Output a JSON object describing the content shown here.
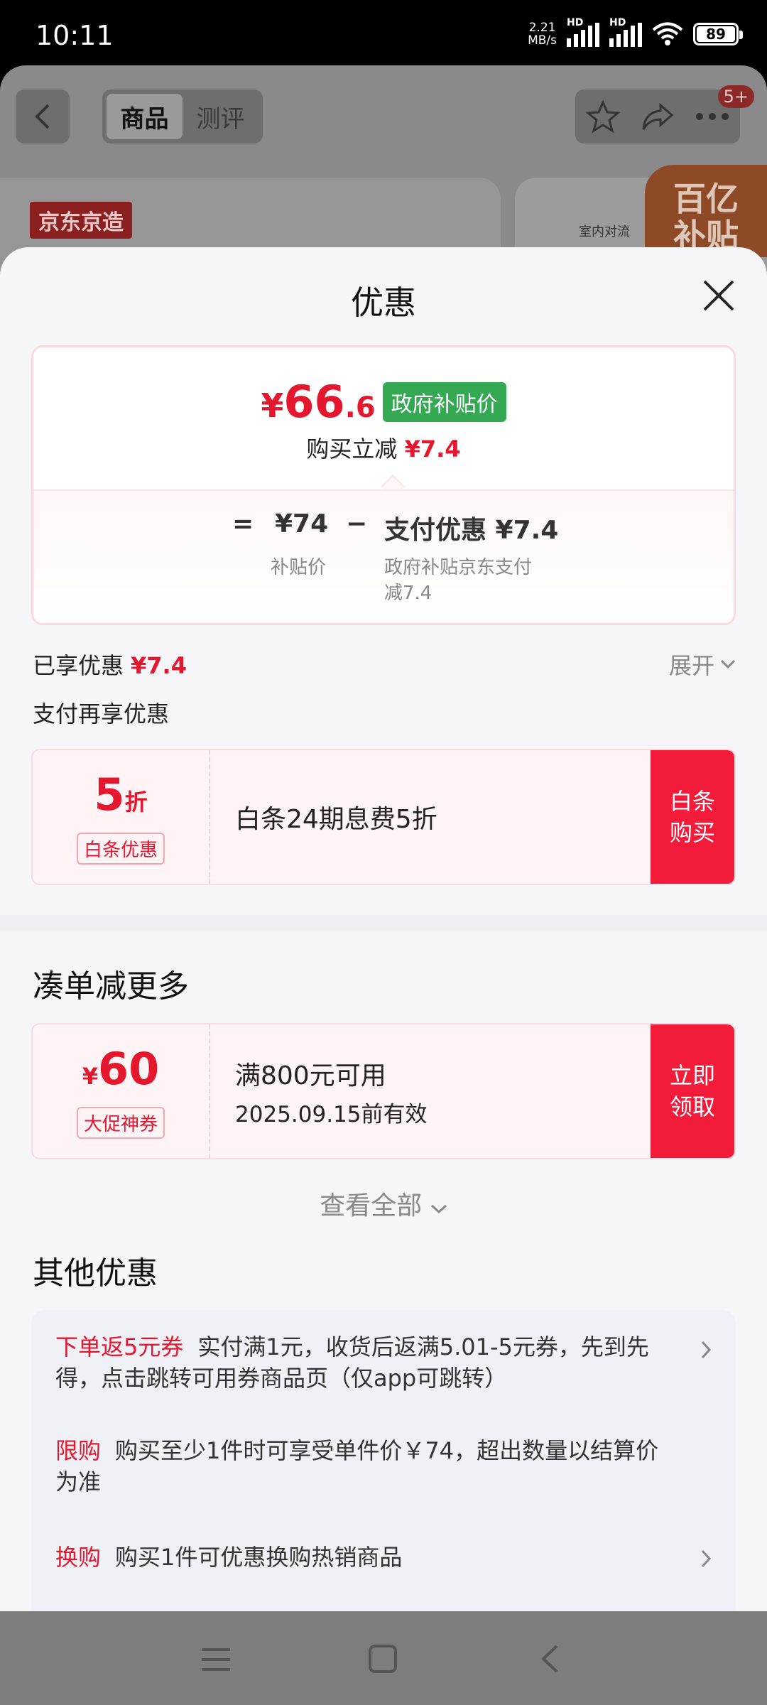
{
  "status_bar": {
    "time": "10:11",
    "net_speed_value": "2.21",
    "net_speed_unit": "MB/s",
    "sim1": "HD",
    "sim2": "HD",
    "battery": "89"
  },
  "background_page": {
    "tabs": [
      "商品",
      "测评"
    ],
    "badge": "5+",
    "brand_logo": "京东京造",
    "subsidy_label_line1": "百亿",
    "subsidy_label_line2": "补贴",
    "small_text": "室内对流"
  },
  "sheet": {
    "title": "优惠",
    "price": {
      "currency": "¥",
      "integer": "66",
      "decimal": ".6",
      "tag": "政府补贴价",
      "reduce_label": "购买立减",
      "reduce_amount": "¥7.4"
    },
    "breakdown": {
      "eq": "=",
      "subsidy_value": "¥74",
      "subsidy_label": "补贴价",
      "minus": "−",
      "pay_value": "支付优惠 ¥7.4",
      "pay_label_line1": "政府补贴京东支付",
      "pay_label_line2": "减7.4"
    },
    "enjoyed_label": "已享优惠",
    "enjoyed_amount": "¥7.4",
    "expand_label": "展开",
    "pay_again_label": "支付再享优惠",
    "baitiao": {
      "value": "5",
      "unit": "折",
      "tag": "白条优惠",
      "desc": "白条24期息费5折",
      "button": "白条购买"
    },
    "more_title": "凑单减更多",
    "coupon": {
      "currency": "¥",
      "value": "60",
      "tag": "大促神券",
      "desc": "满800元可用",
      "expiry": "2025.09.15前有效",
      "button": "立即领取"
    },
    "view_all": "查看全部",
    "other_title": "其他优惠",
    "other": [
      {
        "label": "下单返5元券",
        "text": "实付满1元，收货后返满5.01-5元券，先到先得，点击跳转可用券商品页（仅app可跳转）"
      },
      {
        "label": "限购",
        "text": "购买至少1件时可享受单件价￥74，超出数量以结算价为准"
      },
      {
        "label": "换购",
        "text": "购买1件可优惠换购热销商品"
      }
    ]
  },
  "colors": {
    "accent_red": "#e5172f",
    "button_red": "#f21c3a",
    "gov_green": "#34a853"
  }
}
